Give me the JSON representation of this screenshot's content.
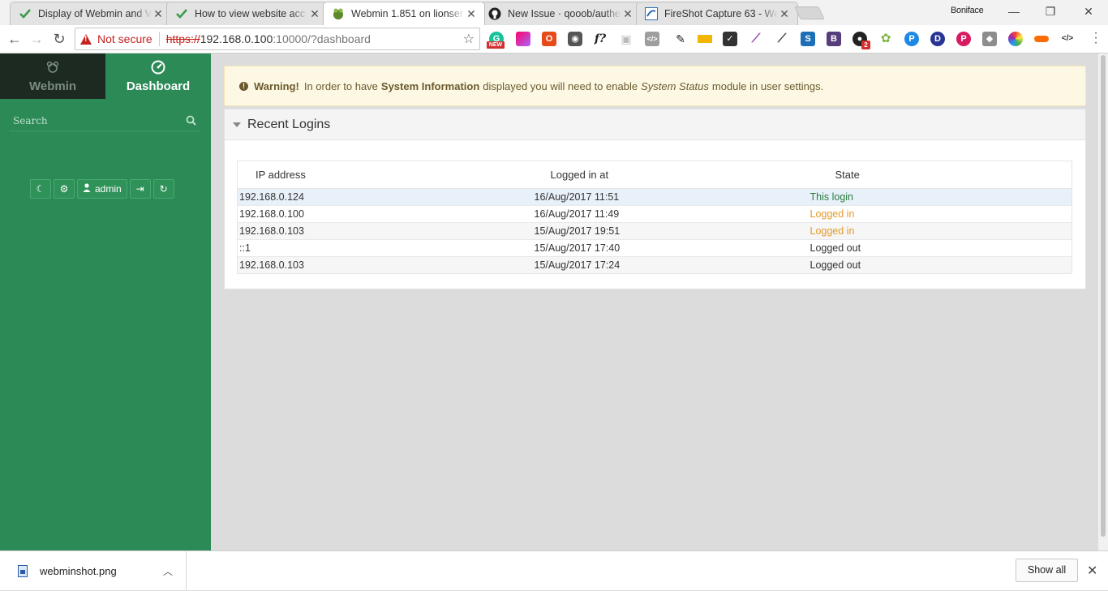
{
  "browser": {
    "tabs": [
      {
        "title": "Display of Webmin and V",
        "icon": "webmin-check-icon",
        "active": false
      },
      {
        "title": "How to view website acc",
        "icon": "webmin-check-icon",
        "active": false
      },
      {
        "title": "Webmin 1.851 on lionser",
        "icon": "webmin-logo-icon",
        "active": true
      },
      {
        "title": "New Issue · qooob/authe",
        "icon": "github-icon",
        "active": false
      },
      {
        "title": "FireShot Capture 63 - We",
        "icon": "fireshot-icon",
        "active": false
      }
    ],
    "profile_name": "Boniface",
    "address": {
      "security_label": "Not secure",
      "scheme": "https://",
      "host": "192.168.0.100",
      "path": ":10000/?dashboard"
    },
    "extensions": [
      "grammarly-icon",
      "gradient-icon",
      "office-icon",
      "keeper-icon",
      "fx-icon",
      "camera-icon",
      "code-icon",
      "pen-icon",
      "ruler-icon",
      "check-icon",
      "feather-icon",
      "eyedropper-icon",
      "s-icon",
      "bootstrap-icon",
      "badge-icon",
      "leaf-icon",
      "p-icon",
      "d-icon",
      "pinterest-icon",
      "box-icon",
      "color-wheel-icon",
      "lens-icon",
      "html-tag-icon"
    ],
    "extension_badges": {
      "new": "NEW",
      "count": "2"
    }
  },
  "sidebar": {
    "tabs": [
      {
        "label": "Webmin",
        "icon": "webmin-logo-icon"
      },
      {
        "label": "Dashboard",
        "icon": "dashboard-gauge-icon"
      }
    ],
    "search_placeholder": "Search",
    "user_label": "admin"
  },
  "alert": {
    "title": "Warning!",
    "text1": "In order to have",
    "bold": "System Information",
    "text2": "displayed you will need to enable",
    "italic": "System Status",
    "text3": "module in user settings."
  },
  "recent_logins": {
    "title": "Recent Logins",
    "columns": [
      "IP address",
      "Logged in at",
      "State"
    ],
    "rows": [
      {
        "ip": "192.168.0.124",
        "at": "16/Aug/2017 11:51",
        "state": "This login",
        "state_color": "#2a7a3e"
      },
      {
        "ip": "192.168.0.100",
        "at": "16/Aug/2017 11:49",
        "state": "Logged in",
        "state_color": "#e49a28"
      },
      {
        "ip": "192.168.0.103",
        "at": "15/Aug/2017 19:51",
        "state": "Logged in",
        "state_color": "#e49a28"
      },
      {
        "ip": "::1",
        "at": "15/Aug/2017 17:40",
        "state": "Logged out",
        "state_color": "#333333"
      },
      {
        "ip": "192.168.0.103",
        "at": "15/Aug/2017 17:24",
        "state": "Logged out",
        "state_color": "#333333"
      }
    ]
  },
  "downloads": {
    "file_name": "webminshot.png",
    "show_all_label": "Show all"
  },
  "colors": {
    "sidebar_green": "#2b8a56",
    "sidebar_dark": "#1d2a22",
    "warning_bg": "#fcf8e3",
    "insecure_red": "#c5221f"
  }
}
